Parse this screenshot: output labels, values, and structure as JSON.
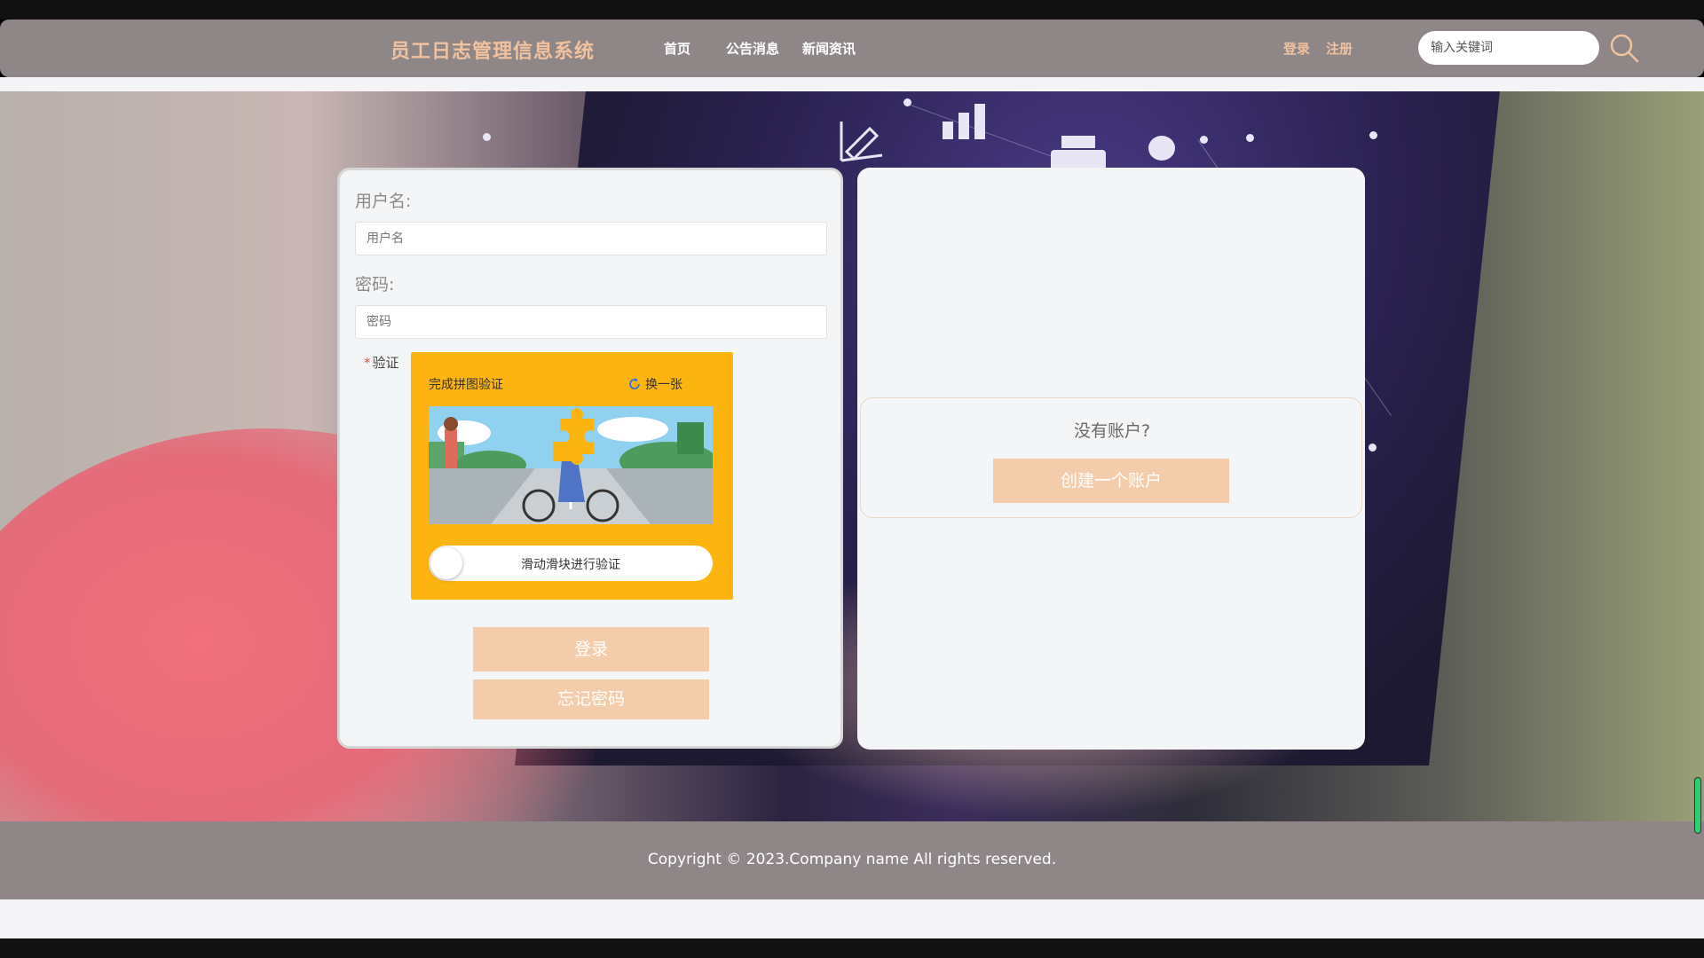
{
  "header": {
    "logo": "员工日志管理信息系统",
    "nav": [
      "首页",
      "公告消息",
      "新闻资讯"
    ],
    "login_link": "登录",
    "register_link": "注册",
    "search_placeholder": "输入关键词"
  },
  "login_form": {
    "username_label": "用户名:",
    "username_placeholder": "用户名",
    "password_label": "密码:",
    "password_placeholder": "密码",
    "verify_required_mark": "*",
    "verify_label": "验证",
    "captcha": {
      "title": "完成拼图验证",
      "refresh": "换一张",
      "slider_text": "滑动滑块进行验证"
    },
    "login_button": "登录",
    "forgot_button": "忘记密码"
  },
  "signup": {
    "prompt": "没有账户?",
    "create_button": "创建一个账户"
  },
  "footer": {
    "copyright": "Copyright © 2023.Company name All rights reserved."
  },
  "colors": {
    "navbar": "#8f8688",
    "accent": "#f0c29e",
    "button": "#f3ccac",
    "captcha_bg": "#fcb510",
    "panel": "#f3f5f6"
  }
}
